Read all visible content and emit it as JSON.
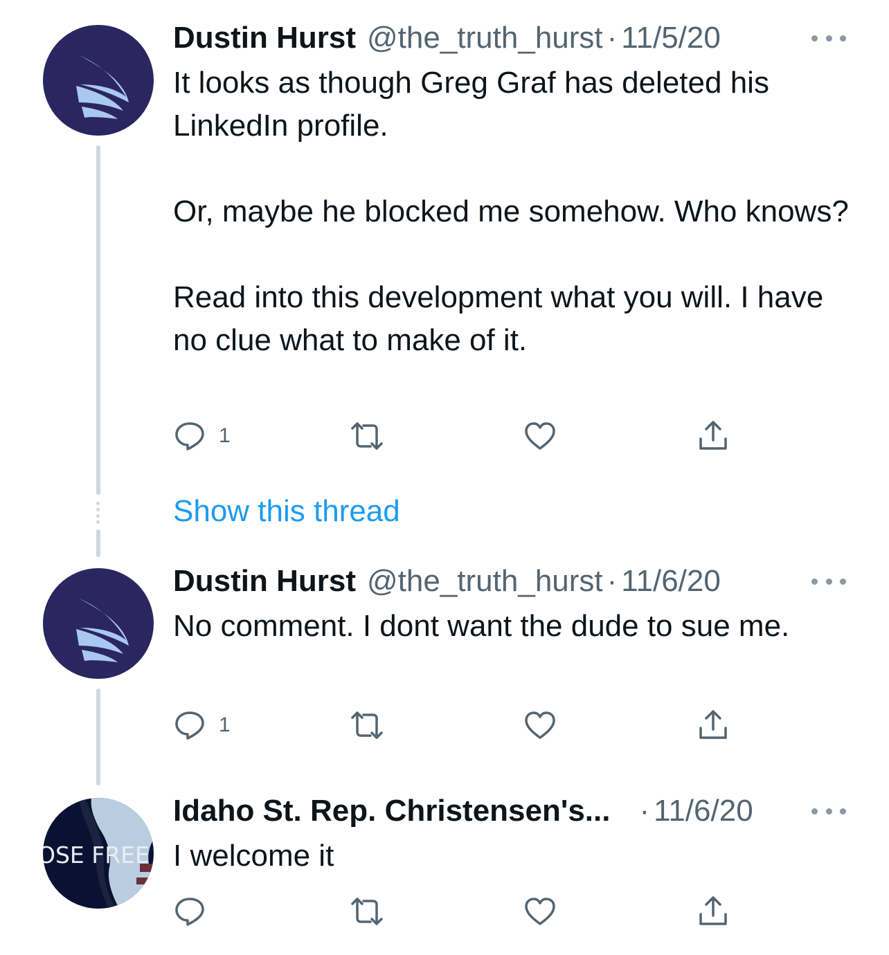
{
  "tweets": [
    {
      "name": "Dustin Hurst",
      "handle": "@the_truth_hurst",
      "separator": "·",
      "date": "11/5/20",
      "text": "It looks as though Greg Graf has deleted his LinkedIn profile.\n\nOr, maybe he blocked me somehow. Who knows?\n\nRead into this development what you will. I have no clue what to make of it.",
      "reply_count": "1"
    },
    {
      "name": "Dustin Hurst",
      "handle": "@the_truth_hurst",
      "separator": "·",
      "date": "11/6/20",
      "text": "No comment. I dont want the dude to sue me.",
      "reply_count": "1"
    },
    {
      "name": "Idaho St. Rep. Christensen's...",
      "handle": "",
      "separator": "·",
      "date": "11/6/20",
      "text": "I welcome it",
      "reply_count": "",
      "avatar_text": "OSE FREE"
    }
  ],
  "show_thread_label": "Show this thread",
  "icons": {
    "reply": "reply-icon",
    "retweet": "retweet-icon",
    "like": "like-icon",
    "share": "share-icon",
    "more": "more-icon"
  },
  "colors": {
    "text": "#0f1419",
    "secondary": "#536471",
    "link": "#1d9bf0",
    "brand_avatar": "#2b2560",
    "thread_line": "#cfd9de"
  }
}
